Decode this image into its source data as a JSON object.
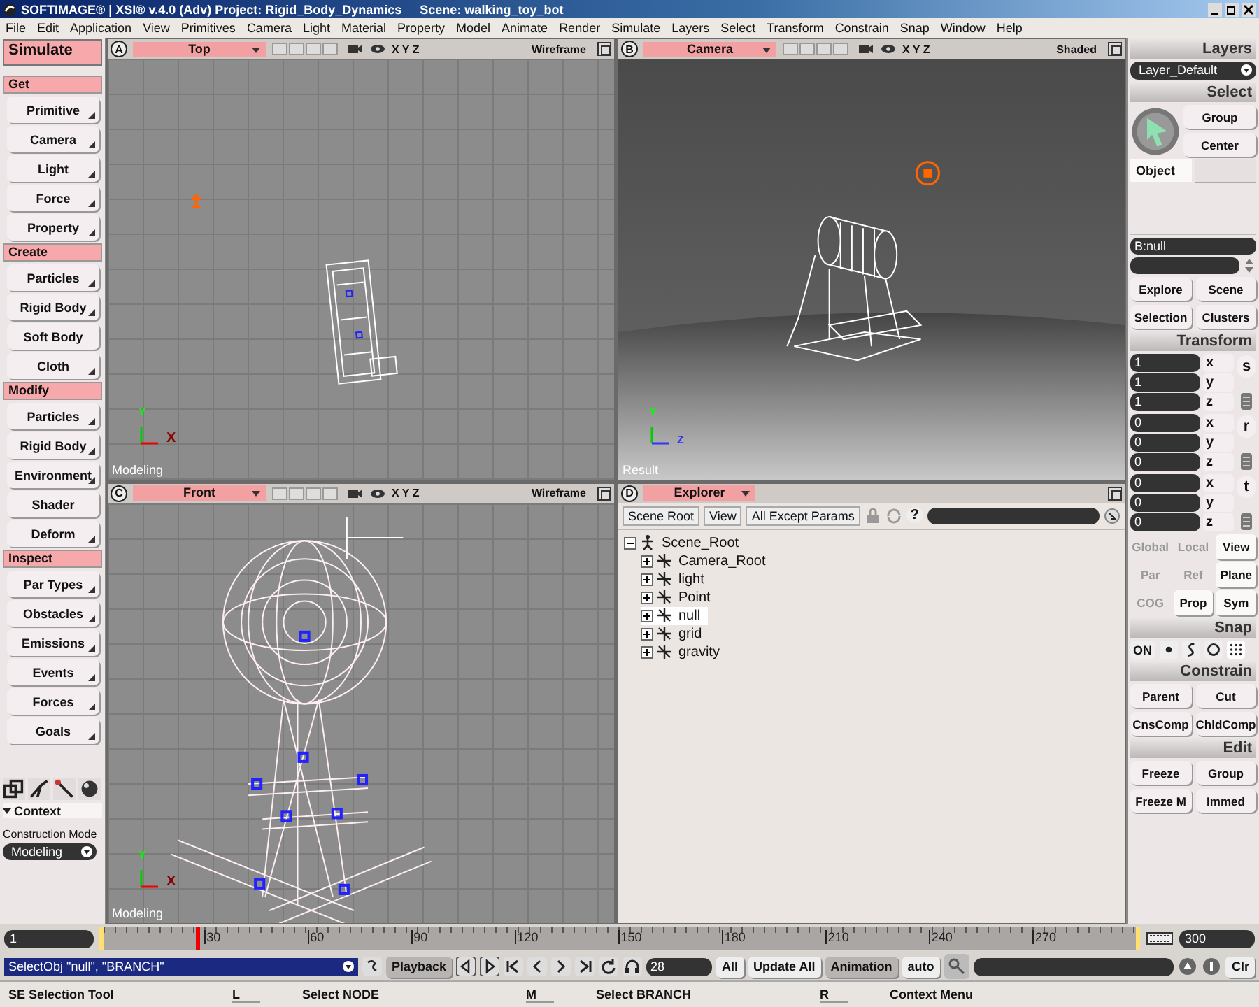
{
  "window": {
    "title": "SOFTIMAGE® | XSI® v.4.0 (Adv) Project: Rigid_Body_Dynamics",
    "scene": "Scene: walking_toy_bot"
  },
  "menu": [
    "File",
    "Edit",
    "Application",
    "View",
    "Primitives",
    "Camera",
    "Light",
    "Material",
    "Property",
    "Model",
    "Animate",
    "Render",
    "Simulate",
    "Layers",
    "Select",
    "Transform",
    "Constrain",
    "Snap",
    "Window",
    "Help"
  ],
  "left_panel": {
    "title": "Simulate",
    "sections": [
      {
        "label": "Get",
        "buttons": [
          {
            "label": "Primitive",
            "menu": true
          },
          {
            "label": "Camera",
            "menu": true
          },
          {
            "label": "Light",
            "menu": true
          },
          {
            "label": "Force",
            "menu": true
          },
          {
            "label": "Property",
            "menu": true
          }
        ]
      },
      {
        "label": "Create",
        "buttons": [
          {
            "label": "Particles",
            "menu": true
          },
          {
            "label": "Rigid Body",
            "menu": true
          },
          {
            "label": "Soft Body",
            "menu": false
          },
          {
            "label": "Cloth",
            "menu": true
          }
        ]
      },
      {
        "label": "Modify",
        "buttons": [
          {
            "label": "Particles",
            "menu": true
          },
          {
            "label": "Rigid Body",
            "menu": true
          },
          {
            "label": "Environment",
            "menu": true
          },
          {
            "label": "Shader",
            "menu": false
          },
          {
            "label": "Deform",
            "menu": true
          }
        ]
      },
      {
        "label": "Inspect",
        "buttons": [
          {
            "label": "Par Types",
            "menu": true
          },
          {
            "label": "Obstacles",
            "menu": true
          },
          {
            "label": "Emissions",
            "menu": true
          },
          {
            "label": "Events",
            "menu": true
          },
          {
            "label": "Forces",
            "menu": true
          },
          {
            "label": "Goals",
            "menu": true
          }
        ]
      }
    ],
    "context": {
      "label": "Context",
      "expanded": true
    },
    "construction_label": "Construction Mode",
    "construction_mode": "Modeling"
  },
  "viewports": [
    {
      "letter": "A",
      "view": "Top",
      "axes_label": "X Y Z",
      "mode": "Wireframe",
      "overlay": "Modeling",
      "kind": "top",
      "axes": [
        "Y",
        "X"
      ]
    },
    {
      "letter": "B",
      "view": "Camera",
      "axes_label": "X Y Z",
      "mode": "Shaded",
      "overlay": "Result",
      "kind": "camera",
      "axes": [
        "Y",
        "Z"
      ]
    },
    {
      "letter": "C",
      "view": "Front",
      "axes_label": "X Y Z",
      "mode": "Wireframe",
      "overlay": "Modeling",
      "kind": "front",
      "axes": [
        "Y",
        "X"
      ]
    }
  ],
  "explorer": {
    "letter": "D",
    "title": "Explorer",
    "toolbar": [
      "Scene Root",
      "View",
      "All Except Params"
    ],
    "help": "?",
    "tree": [
      {
        "label": "Scene_Root",
        "expanded": true,
        "selected": false,
        "children": [
          {
            "label": "Camera_Root",
            "expanded": false,
            "selected": false
          },
          {
            "label": "light",
            "expanded": false,
            "selected": false
          },
          {
            "label": "Point",
            "expanded": false,
            "selected": false
          },
          {
            "label": "null",
            "expanded": false,
            "selected": true
          },
          {
            "label": "grid",
            "expanded": false,
            "selected": false
          },
          {
            "label": "gravity",
            "expanded": false,
            "selected": false
          }
        ]
      }
    ]
  },
  "right_panel": {
    "layers": {
      "title": "Layers",
      "value": "Layer_Default"
    },
    "select": {
      "title": "Select",
      "buttons": [
        "Group",
        "Center"
      ],
      "tabs": [
        {
          "label": "Object",
          "selected": true
        }
      ],
      "name_field": "B:null",
      "nav": [
        "Explore",
        "Scene",
        "Selection",
        "Clusters"
      ]
    },
    "transform": {
      "title": "Transform",
      "groups": [
        {
          "tool": "s",
          "rows": [
            {
              "value": "1",
              "axis": "x"
            },
            {
              "value": "1",
              "axis": "y"
            },
            {
              "value": "1",
              "axis": "z"
            }
          ]
        },
        {
          "tool": "r",
          "rows": [
            {
              "value": "0",
              "axis": "x"
            },
            {
              "value": "0",
              "axis": "y"
            },
            {
              "value": "0",
              "axis": "z"
            }
          ]
        },
        {
          "tool": "t",
          "rows": [
            {
              "value": "0",
              "axis": "x"
            },
            {
              "value": "0",
              "axis": "y"
            },
            {
              "value": "0",
              "axis": "z"
            }
          ]
        }
      ],
      "modes": [
        [
          {
            "label": "Global",
            "selected": false
          },
          {
            "label": "Local",
            "selected": false
          },
          {
            "label": "View",
            "selected": true
          }
        ],
        [
          {
            "label": "Par",
            "selected": false
          },
          {
            "label": "Ref",
            "selected": false
          },
          {
            "label": "Plane",
            "selected": true
          }
        ],
        [
          {
            "label": "COG",
            "selected": false
          },
          {
            "label": "Prop",
            "selected": true
          },
          {
            "label": "Sym",
            "selected": true
          }
        ]
      ]
    },
    "snap": {
      "title": "Snap",
      "on": "ON"
    },
    "constrain": {
      "title": "Constrain",
      "buttons": [
        "Parent",
        "Cut",
        "CnsComp",
        "ChldComp"
      ]
    },
    "edit": {
      "title": "Edit",
      "buttons": [
        "Freeze",
        "Group",
        "Freeze M",
        "Immed"
      ]
    }
  },
  "timeline": {
    "start": "1",
    "end": "300",
    "ticks": [
      "30",
      "60",
      "90",
      "120",
      "150",
      "180",
      "210",
      "240",
      "270"
    ],
    "level": 0.09
  },
  "command": {
    "value": "SelectObj \"null\", \"BRANCH\"",
    "playback": "Playback",
    "frame": "28",
    "all": "All",
    "update_all": "Update All",
    "animation": "Animation",
    "auto": "auto",
    "clear": "Clr"
  },
  "status": [
    {
      "text": "SE Selection Tool"
    },
    {
      "key": "L",
      "text": "Select NODE"
    },
    {
      "key": "M",
      "text": "Select BRANCH"
    },
    {
      "key": "R",
      "text": "Context Menu"
    }
  ]
}
